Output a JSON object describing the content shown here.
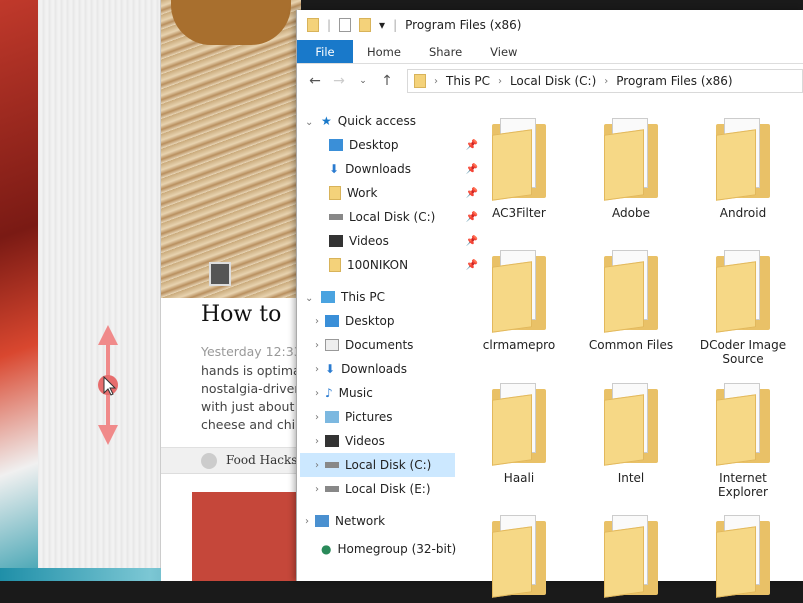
{
  "background": {
    "article": {
      "title": "How to",
      "meta": "Yesterday 12:33",
      "body": [
        "hands is optima",
        "nostalgia-driven",
        "with just about",
        "cheese and chil"
      ],
      "tag": "Food Hacks"
    }
  },
  "explorer": {
    "title": "Program Files (x86)",
    "ribbon": [
      "File",
      "Home",
      "Share",
      "View"
    ],
    "breadcrumb": [
      "This PC",
      "Local Disk (C:)",
      "Program Files (x86)"
    ],
    "nav": {
      "quick_access": "Quick access",
      "quick_items": [
        "Desktop",
        "Downloads",
        "Work",
        "Local Disk (C:)",
        "Videos",
        "100NIKON"
      ],
      "this_pc": "This PC",
      "pc_items": [
        "Desktop",
        "Documents",
        "Downloads",
        "Music",
        "Pictures",
        "Videos",
        "Local Disk (C:)",
        "Local Disk (E:)"
      ],
      "network": "Network",
      "homegroup": "Homegroup (32-bit)"
    },
    "folders": [
      "AC3Filter",
      "Adobe",
      "Android",
      "clrmamepro",
      "Common Files",
      "DCoder Image Source",
      "Haali",
      "Intel",
      "Internet Explorer",
      "",
      "",
      ""
    ],
    "selected_nav": "Local Disk (C:)",
    "accent": "#1979ca"
  }
}
